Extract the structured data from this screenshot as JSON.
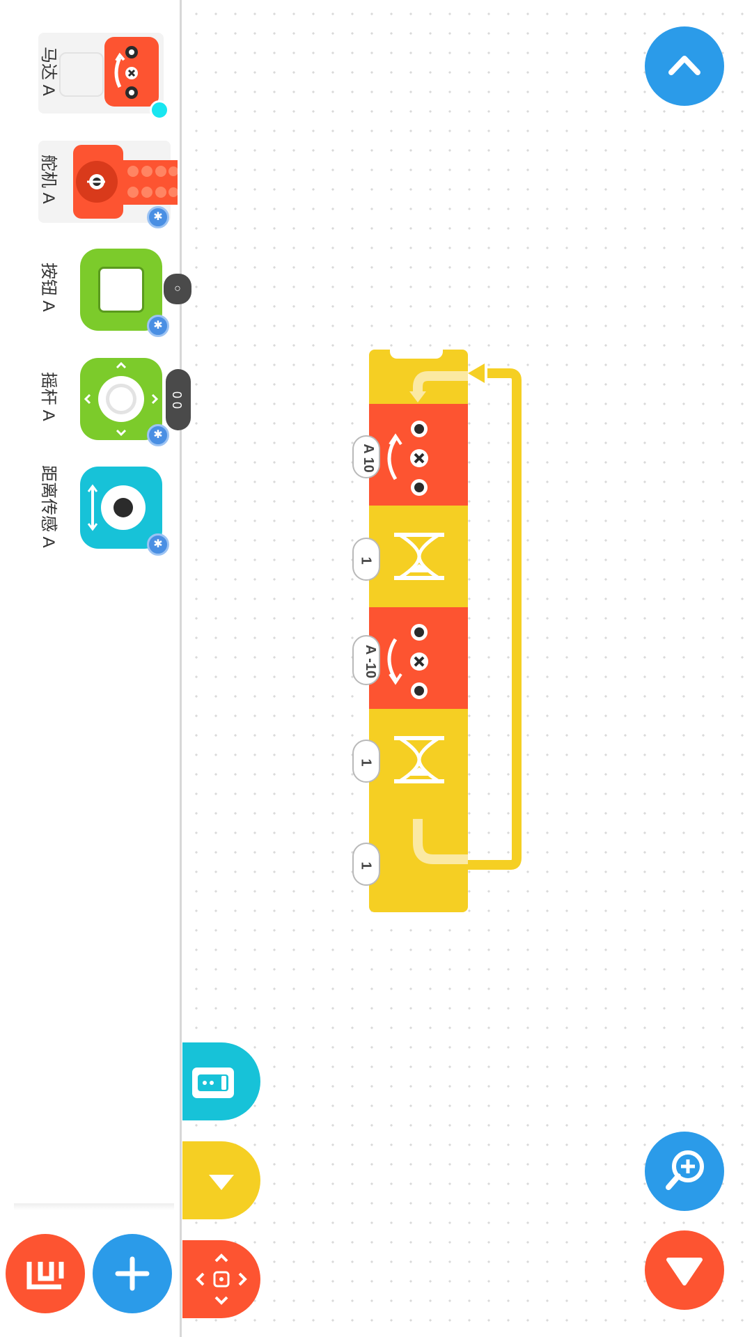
{
  "devices": [
    {
      "label": "马达 A",
      "icon": "motor-icon",
      "status": "connected-indicator"
    },
    {
      "label": "舵机 A",
      "icon": "servo-icon",
      "status": "bluetooth-icon"
    },
    {
      "label": "按钮 A",
      "icon": "button-sensor-icon",
      "status": "bluetooth-icon",
      "tooltip": "○"
    },
    {
      "label": "摇杆 A",
      "icon": "joystick-icon",
      "status": "bluetooth-icon",
      "tooltip": "0 0"
    },
    {
      "label": "距离传感 A",
      "icon": "distance-sensor-icon",
      "status": "bluetooth-icon"
    }
  ],
  "script": {
    "blocks": [
      {
        "type": "repeat-start",
        "color": "#f5cf23"
      },
      {
        "type": "motor",
        "param": "A 10",
        "color": "#fd5431"
      },
      {
        "type": "wait",
        "param": "1",
        "color": "#f5cf23"
      },
      {
        "type": "motor",
        "param": "A -10",
        "color": "#fd5431"
      },
      {
        "type": "wait",
        "param": "1",
        "color": "#f5cf23"
      },
      {
        "type": "repeat-end",
        "param": "1",
        "color": "#f5cf23"
      }
    ]
  },
  "colors": {
    "red": "#fd5431",
    "yellow": "#f5cf23",
    "green": "#7ccb2b",
    "cyan": "#17c2d8",
    "blue": "#2b9be9"
  }
}
